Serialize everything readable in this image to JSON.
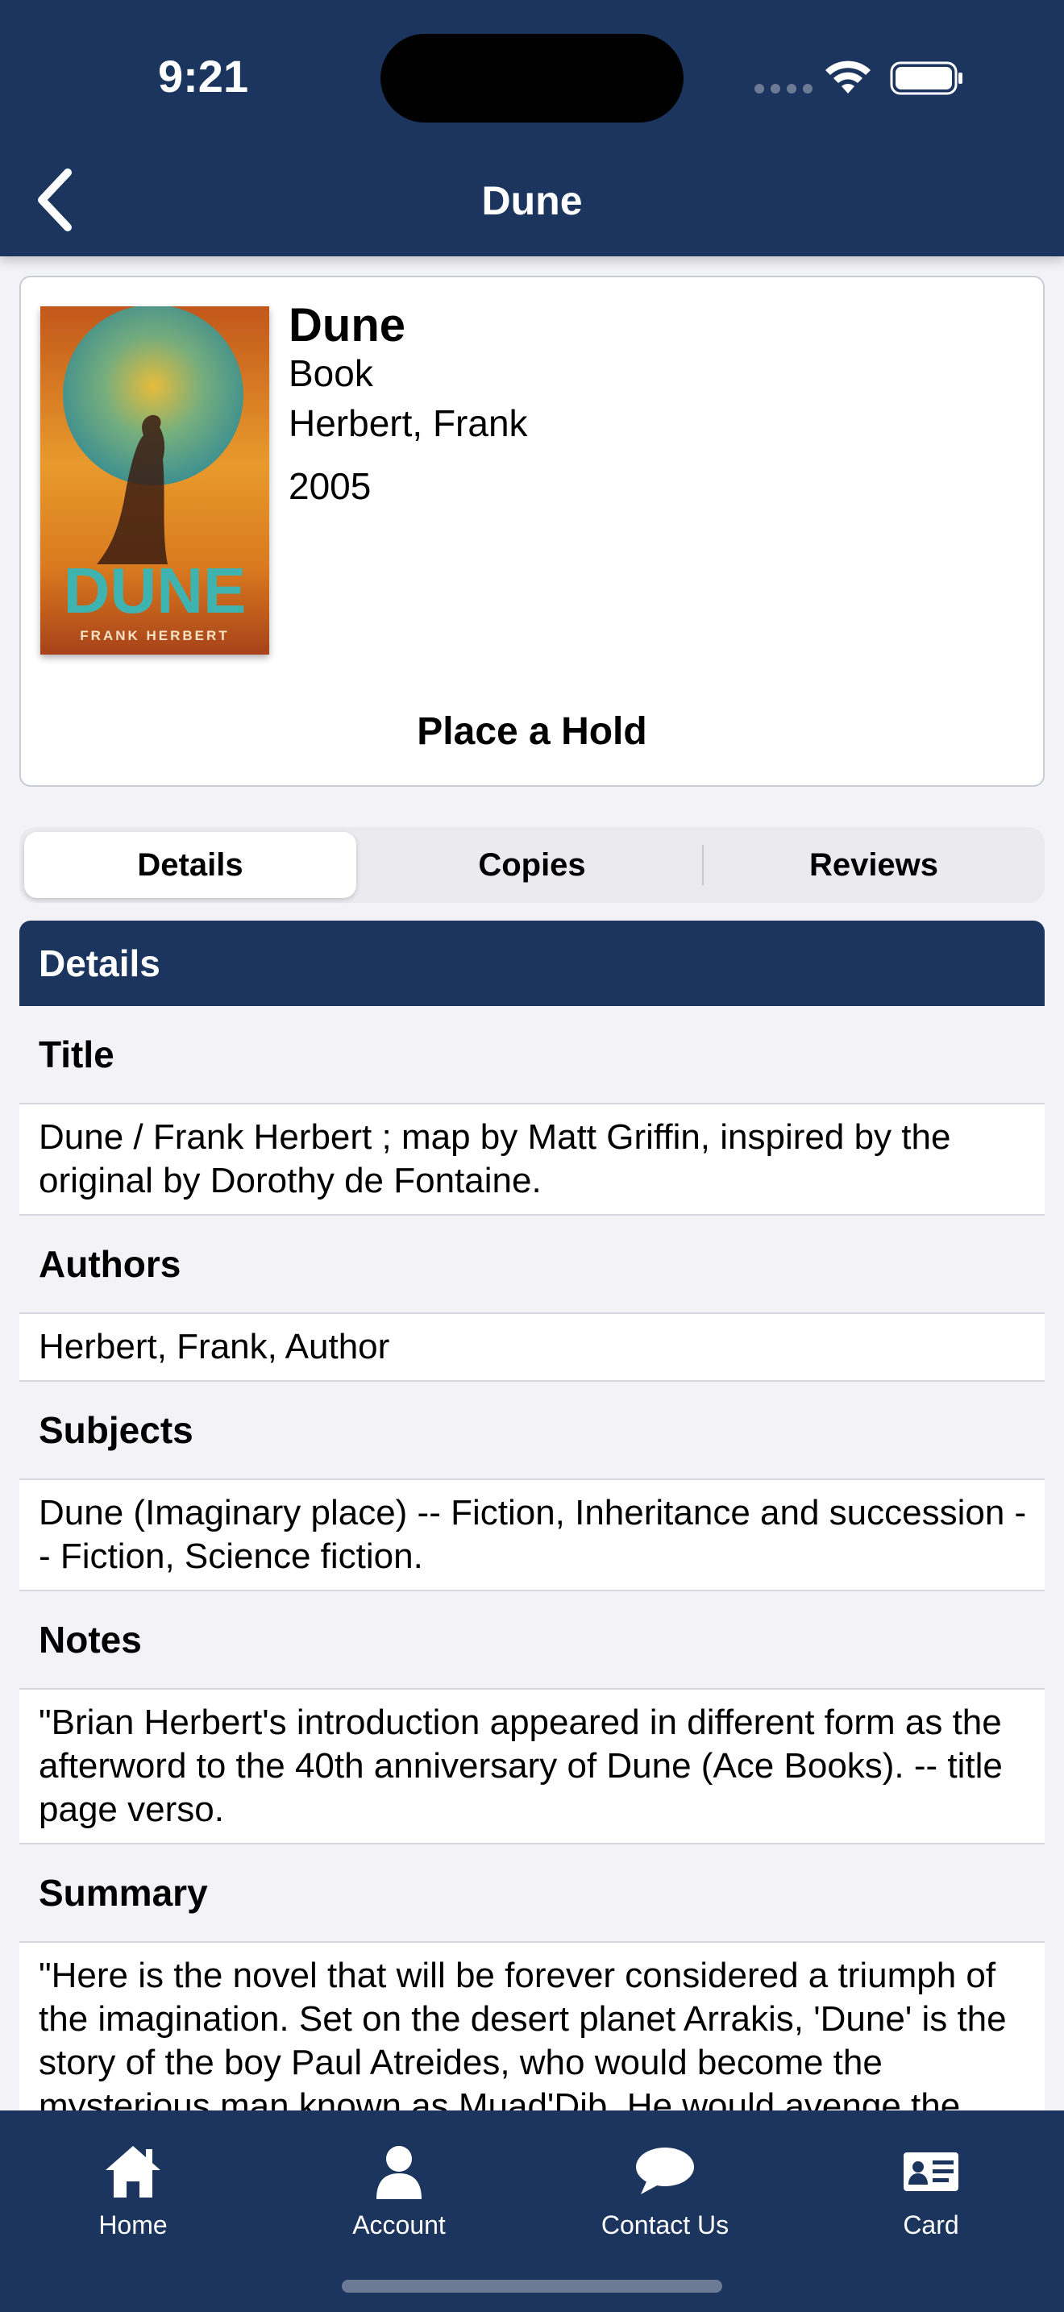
{
  "status_bar": {
    "time": "9:21"
  },
  "nav": {
    "title": "Dune"
  },
  "book": {
    "title": "Dune",
    "format": "Book",
    "author": "Herbert, Frank",
    "year": "2005",
    "hold_label": "Place a Hold",
    "cover": {
      "title_text": "DUNE",
      "author_text": "FRANK HERBERT"
    }
  },
  "tabs": [
    {
      "label": "Details",
      "selected": true
    },
    {
      "label": "Copies",
      "selected": false
    },
    {
      "label": "Reviews",
      "selected": false
    }
  ],
  "details": {
    "header": "Details",
    "sections": [
      {
        "label": "Title",
        "value": "Dune / Frank Herbert ; map by Matt Griffin, inspired by the original by Dorothy de Fontaine."
      },
      {
        "label": "Authors",
        "value": "Herbert, Frank, Author"
      },
      {
        "label": "Subjects",
        "value": "Dune (Imaginary place) -- Fiction, Inheritance and succession -- Fiction, Science fiction."
      },
      {
        "label": "Notes",
        "value": "\"Brian Herbert's introduction appeared in different form as the afterword to the 40th anniversary of Dune (Ace Books). -- title page verso."
      },
      {
        "label": "Summary",
        "value": "\"Here is the novel that will be forever considered a triumph of the imagination. Set on the desert planet Arrakis, 'Dune' is the story of the boy Paul Atreides, who would become the mysterious man known as Muad'Dib. He would avenge the traitorous plot against his noble family"
      }
    ]
  },
  "tab_bar": [
    {
      "label": "Home",
      "icon": "home-icon"
    },
    {
      "label": "Account",
      "icon": "person-icon"
    },
    {
      "label": "Contact Us",
      "icon": "chat-bubble-icon"
    },
    {
      "label": "Card",
      "icon": "card-icon"
    }
  ],
  "colors": {
    "primary": "#1c355e",
    "background": "#f2f2f7",
    "cover_orange": "#d9801d",
    "cover_teal": "#3aa7a8"
  }
}
